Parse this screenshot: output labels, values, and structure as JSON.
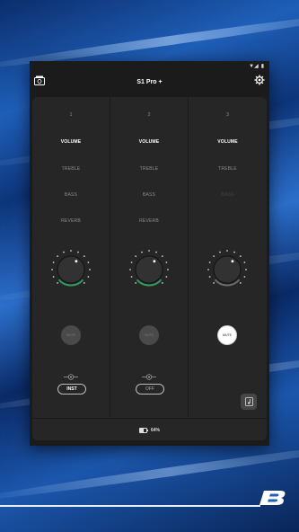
{
  "status_bar": {
    "signal": "▼◢",
    "battery_glyph": "▮"
  },
  "header": {
    "title": "S1 Pro +",
    "left_icon": "speaker-device-icon",
    "right_icon": "gear-icon"
  },
  "channels": [
    {
      "number": "1",
      "tabs": [
        "VOLUME",
        "TREBLE",
        "BASS",
        "REVERB"
      ],
      "active_tab": "VOLUME",
      "level": 0.62,
      "arc_color": "#2e9b5a",
      "mute_label": "MUTE",
      "mute_on": false,
      "mode_label": "INST"
    },
    {
      "number": "2",
      "tabs": [
        "VOLUME",
        "TREBLE",
        "BASS",
        "REVERB"
      ],
      "active_tab": "VOLUME",
      "level": 0.62,
      "arc_color": "#2e9b5a",
      "mute_label": "MUTE",
      "mute_on": false,
      "mode_label": "OFF"
    },
    {
      "number": "3",
      "tabs": [
        "VOLUME",
        "TREBLE",
        "BASS"
      ],
      "active_tab": "VOLUME",
      "level": 0.62,
      "arc_color": "#6b6b6b",
      "mute_label": "MUTE",
      "mute_on": true,
      "mode_label": ""
    }
  ],
  "footer": {
    "battery_text": "64%"
  },
  "colors": {
    "accent_green": "#2e9b5a",
    "panel": "#262626",
    "background_blue": "#1f5fb8"
  }
}
